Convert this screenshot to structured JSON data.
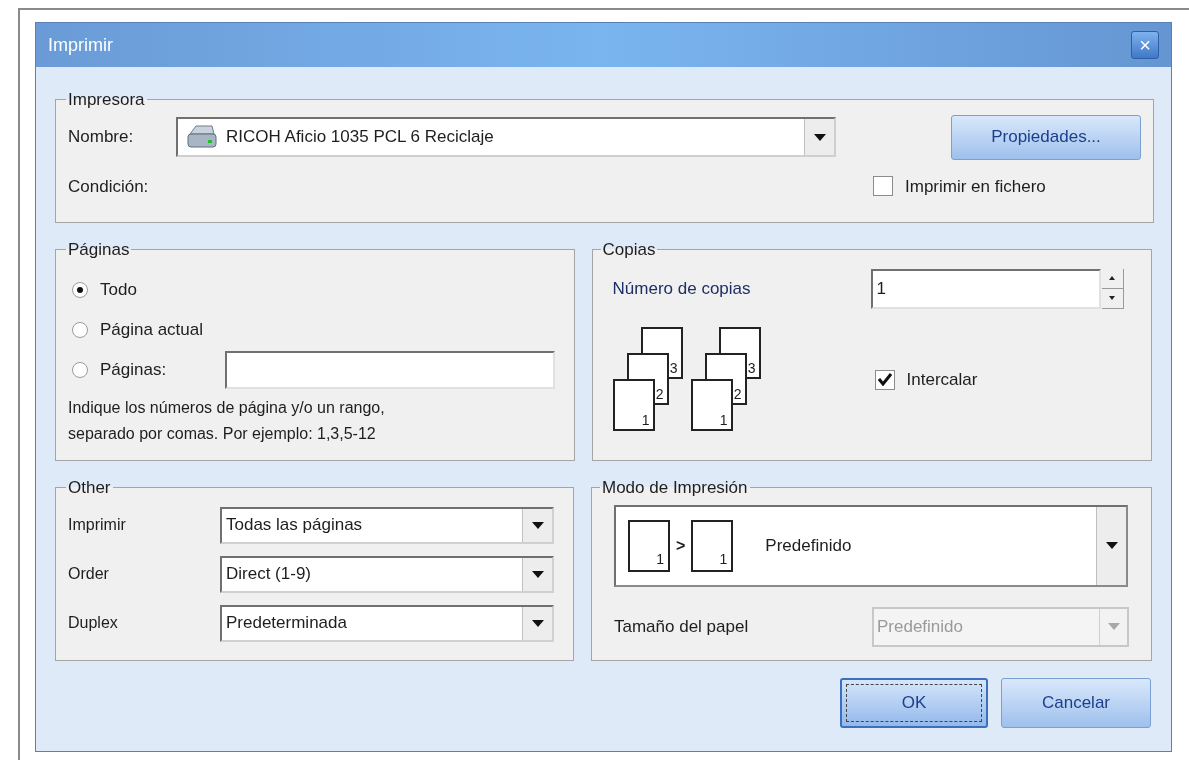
{
  "window": {
    "title": "Imprimir",
    "close_glyph": "×"
  },
  "printer": {
    "group_label": "Impresora",
    "name_label": "Nombre:",
    "name_value": "RICOH Aficio 1035 PCL 6 Reciclaje",
    "properties_button": "Propiedades...",
    "status_label": "Condición:",
    "print_to_file": {
      "label": "Imprimir en fichero",
      "checked": false
    }
  },
  "pages": {
    "group_label": "Páginas",
    "options": [
      {
        "label": "Todo",
        "selected": true,
        "kind": "plain"
      },
      {
        "label": "Página actual",
        "selected": false,
        "kind": "plain"
      },
      {
        "label": "Páginas:",
        "selected": false,
        "kind": "range"
      }
    ],
    "hint": "Indique los números de página y/o un rango,\nseparado por comas. Por ejemplo: 1,3,5-12"
  },
  "copies": {
    "group_label": "Copias",
    "count_label": "Número de copias",
    "count_value": "1",
    "collate_stacks": [
      [
        "3",
        "2",
        "1"
      ],
      [
        "3",
        "2",
        "1"
      ]
    ],
    "collate": {
      "label": "Intercalar",
      "checked": true
    }
  },
  "other": {
    "group_label": "Other",
    "rows": [
      {
        "label": "Imprimir",
        "value": "Todas las páginas"
      },
      {
        "label": "Order",
        "value": "Direct (1-9)"
      },
      {
        "label": "Duplex",
        "value": "Predeterminada"
      }
    ]
  },
  "print_mode": {
    "group_label": "Modo de Impresión",
    "mode_sheets": [
      "1",
      "1"
    ],
    "mode_arrow": ">",
    "mode_value": "Predefinido",
    "paper_size": {
      "label": "Tamaño del papel",
      "value": "Predefinido",
      "disabled": true
    }
  },
  "buttons": [
    {
      "label": "OK",
      "kind": "default"
    },
    {
      "label": "Cancelar",
      "kind": "normal"
    }
  ]
}
